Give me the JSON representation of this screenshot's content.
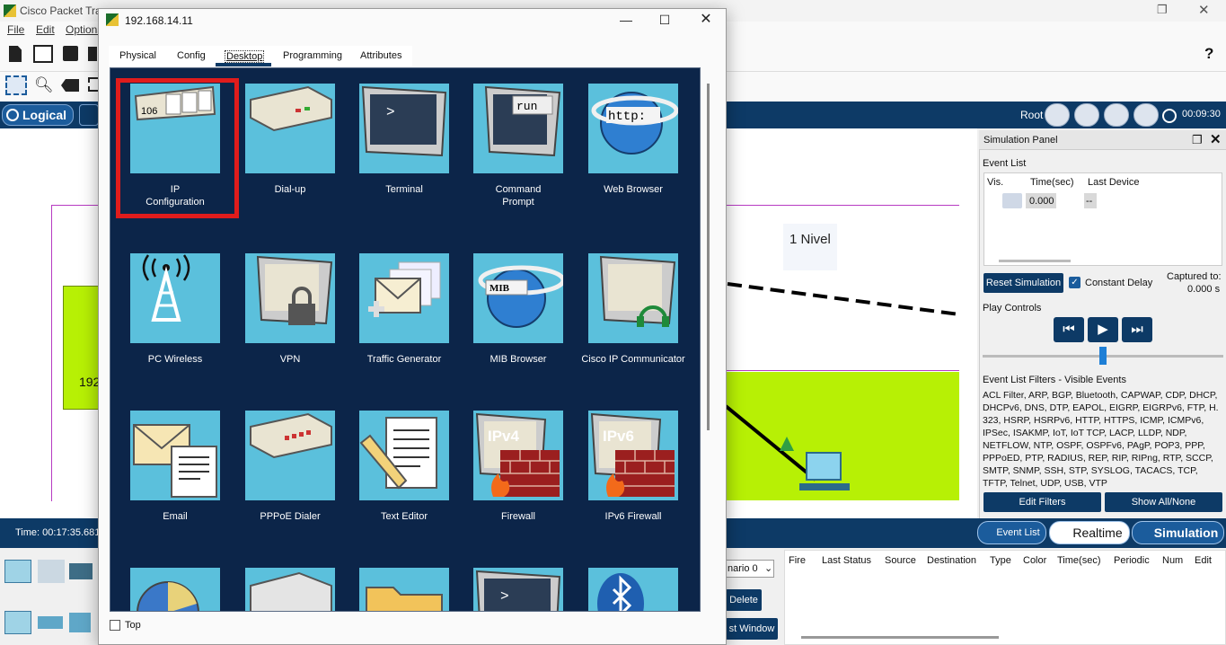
{
  "main_window": {
    "title": "Cisco Packet Tra",
    "menu": [
      "File",
      "Edit",
      "Options"
    ],
    "help": "?"
  },
  "nav": {
    "logical_tab": "Logical",
    "root_label": "Root",
    "clock": "00:09:30"
  },
  "workspace": {
    "level_label": "1 Nivel",
    "left_ip_fragment": "192"
  },
  "sim_panel": {
    "title": "Simulation Panel",
    "event_list_label": "Event List",
    "columns": [
      "Vis.",
      "Time(sec)",
      "Last Device"
    ],
    "row": {
      "time": "0.000",
      "last_device": "--"
    },
    "reset_button": "Reset Simulation",
    "constant_delay": "Constant Delay",
    "captured_label": "Captured to:",
    "captured_value": "0.000 s",
    "play_controls": "Play Controls",
    "filters_title": "Event List Filters - Visible Events",
    "filters_text": "ACL Filter, ARP, BGP, Bluetooth, CAPWAP, CDP, DHCP, DHCPv6, DNS, DTP, EAPOL, EIGRP, EIGRPv6, FTP, H. 323, HSRP, HSRPv6, HTTP, HTTPS, ICMP, ICMPv6, IPSec, ISAKMP, IoT, IoT TCP, LACP, LLDP, NDP, NETFLOW, NTP, OSPF, OSPFv6, PAgP, POP3, PPP, PPPoED, PTP, RADIUS, REP, RIP, RIPng, RTP, SCCP, SMTP, SNMP, SSH, STP, SYSLOG, TACACS, TCP, TFTP, Telnet, UDP, USB, VTP",
    "edit_filters": "Edit Filters",
    "show_all": "Show All/None"
  },
  "bottom": {
    "time": "Time: 00:17:35.681",
    "event_list_btn": "Event List",
    "realtime_btn": "Realtime",
    "simulation_btn": "Simulation",
    "scenario_select": "nario 0",
    "delete_btn": "Delete",
    "window_btn": "st Window",
    "pdu_columns": [
      "Fire",
      "Last Status",
      "Source",
      "Destination",
      "Type",
      "Color",
      "Time(sec)",
      "Periodic",
      "Num",
      "Edit"
    ]
  },
  "dialog": {
    "title": "192.168.14.11",
    "tabs": [
      "Physical",
      "Config",
      "Desktop",
      "Programming",
      "Attributes"
    ],
    "active_tab": "Desktop",
    "top_checkbox": "Top",
    "apps": [
      {
        "label1": "IP",
        "label2": "Configuration",
        "icon": "ip-config-icon",
        "badge": "106"
      },
      {
        "label1": "Dial-up",
        "label2": "",
        "icon": "dialup-modem-icon"
      },
      {
        "label1": "Terminal",
        "label2": "",
        "icon": "terminal-icon",
        "badge": ">"
      },
      {
        "label1": "Command",
        "label2": "Prompt",
        "icon": "command-prompt-icon",
        "badge": "run"
      },
      {
        "label1": "Web Browser",
        "label2": "",
        "icon": "web-browser-icon",
        "badge": "http:"
      },
      {
        "label1": "PC Wireless",
        "label2": "",
        "icon": "wireless-tower-icon"
      },
      {
        "label1": "VPN",
        "label2": "",
        "icon": "vpn-lock-icon"
      },
      {
        "label1": "Traffic Generator",
        "label2": "",
        "icon": "traffic-generator-icon"
      },
      {
        "label1": "MIB Browser",
        "label2": "",
        "icon": "mib-browser-icon",
        "badge": "MIB"
      },
      {
        "label1": "Cisco IP Communicator",
        "label2": "",
        "icon": "ip-communicator-icon"
      },
      {
        "label1": "Email",
        "label2": "",
        "icon": "email-icon"
      },
      {
        "label1": "PPPoE Dialer",
        "label2": "",
        "icon": "pppoe-dialer-icon"
      },
      {
        "label1": "Text Editor",
        "label2": "",
        "icon": "text-editor-icon"
      },
      {
        "label1": "Firewall",
        "label2": "",
        "icon": "firewall-icon",
        "badge": "IPv4"
      },
      {
        "label1": "IPv6 Firewall",
        "label2": "",
        "icon": "ipv6-firewall-icon",
        "badge": "IPv6"
      }
    ]
  },
  "colors": {
    "nav_blue": "#0d3a66",
    "tile_cyan": "#5bc0dc",
    "desktop_bg": "#0c2549",
    "highlight_red": "#e01c1c",
    "zone_green": "#b7f005"
  }
}
